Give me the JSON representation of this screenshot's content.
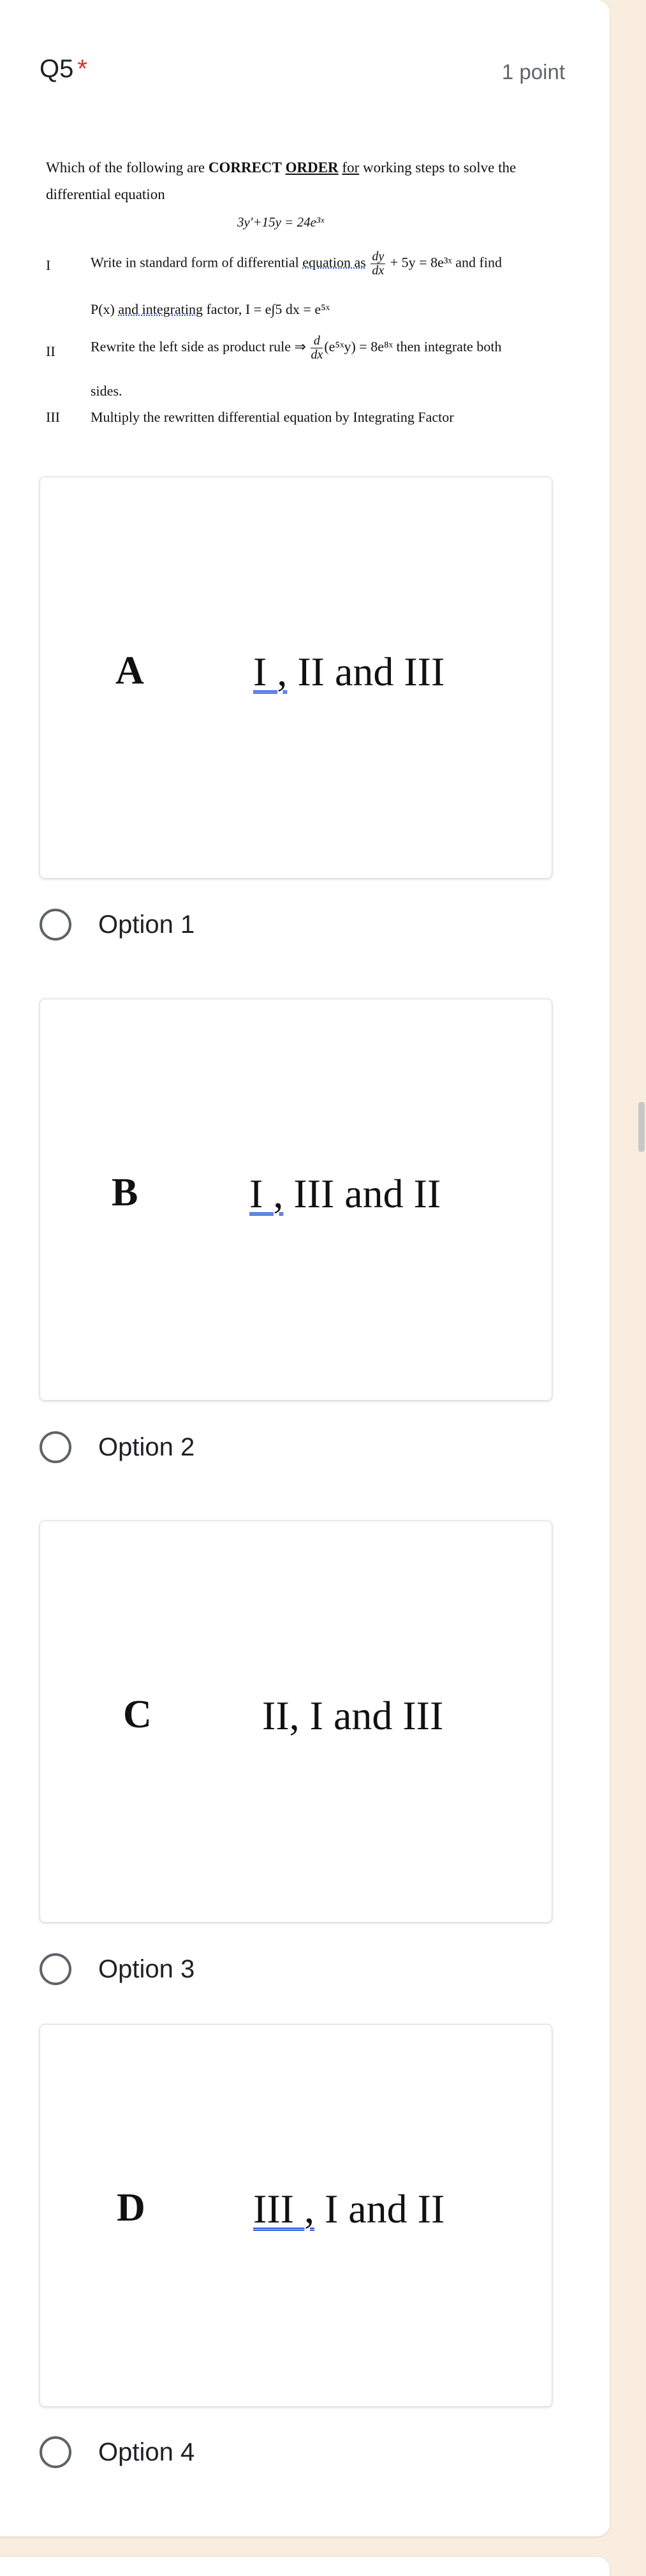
{
  "question": {
    "title": "Q5",
    "required_mark": "*",
    "points": "1 point",
    "prompt": {
      "line1_a": "Which of the following are ",
      "line1_b": "CORRECT",
      "line1_c": "ORDER",
      "line1_d": "for",
      "line1_e": " working steps to solve the",
      "line2": "differential equation",
      "equation": "3y′+15y = 24e³ˣ"
    },
    "steps": [
      {
        "num": "I",
        "text_a": "Write in standard form of differential ",
        "text_b": "equation  as",
        "frac_num": "dy",
        "frac_den": "dx",
        "text_c": "+ 5y = 8e³ˣ  and find"
      },
      {
        "cont_a": "P(x) ",
        "cont_b": "and  integrating",
        "cont_c": " factor, I = e∫5 dx = e⁵ˣ"
      },
      {
        "num": "II",
        "text_a": "Rewrite the left side as product rule ⇒ ",
        "frac_num": "d",
        "frac_den": "dx",
        "text_c": "(e⁵ˣy) = 8e⁸ˣ then integrate both"
      },
      {
        "cont_a": "sides."
      },
      {
        "num": "III",
        "text_a": "Multiply the rewritten differential equation by Integrating Factor"
      }
    ]
  },
  "options": [
    {
      "letter": "A",
      "answer_u": "I ,",
      "answer_rest": " II and III",
      "label": "Option 1"
    },
    {
      "letter": "B",
      "answer_u": "I ,",
      "answer_rest": " III  and  II",
      "label": "Option 2"
    },
    {
      "letter": "C",
      "answer_u": "",
      "answer_rest": "II, I and III",
      "label": "Option 3"
    },
    {
      "letter": "D",
      "answer_u": "III ,",
      "answer_rest": " I and  II",
      "label": "Option 4"
    }
  ]
}
